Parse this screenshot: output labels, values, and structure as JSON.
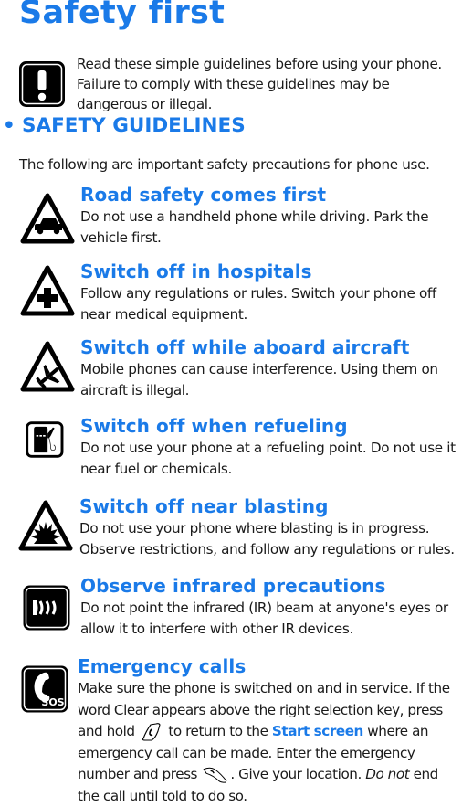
{
  "page": {
    "title": "Safety first",
    "intro": "Read these simple guidelines before using your phone. Failure to comply with these guidelines may be dangerous or illegal.",
    "intro_icon": "warning-exclamation-icon",
    "accent_color": "#1a7ae8"
  },
  "section": {
    "bullet": "•",
    "heading": "SAFETY GUIDELINES",
    "intro": "The following are important safety precautions for phone use."
  },
  "items": [
    {
      "icon": "road-safety-car-icon",
      "title": "Road safety comes first",
      "description": "Do not use a handheld phone while driving. Park the vehicle first."
    },
    {
      "icon": "hospital-cross-icon",
      "title": "Switch off in hospitals",
      "description": "Follow any regulations or rules. Switch your phone off near medical equipment."
    },
    {
      "icon": "aircraft-icon",
      "title": "Switch off while aboard aircraft",
      "description": "Mobile phones can cause interference. Using them on aircraft is illegal."
    },
    {
      "icon": "fuel-pump-icon",
      "title": "Switch off when refueling",
      "description": "Do not use your phone at a refueling point. Do not use it near fuel or chemicals."
    },
    {
      "icon": "blasting-explosion-icon",
      "title": "Switch off near blasting",
      "description": "Do not use your phone where blasting is in progress. Observe restrictions, and follow any regulations or rules."
    },
    {
      "icon": "infrared-beam-icon",
      "title": "Observe infrared precautions",
      "description": "Do not point the infrared (IR) beam at anyone's eyes or allow it to interfere with other IR devices."
    }
  ],
  "emergency": {
    "icon": "sos-phone-icon",
    "title": "Emergency calls",
    "part1": "Make sure the phone is switched on and in service. If the word Clear appears above the right selection key, press and hold",
    "end_key_icon": "end-key-icon",
    "part2": " to return to the ",
    "link": "Start screen",
    "part3": " where an emergency call can be made. Enter the emergency number and press ",
    "call_key_icon": "call-key-icon",
    "part4": ".",
    "part5": " Give your location. ",
    "emphasis": "Do not",
    "part6": " end the call until told to do so."
  }
}
